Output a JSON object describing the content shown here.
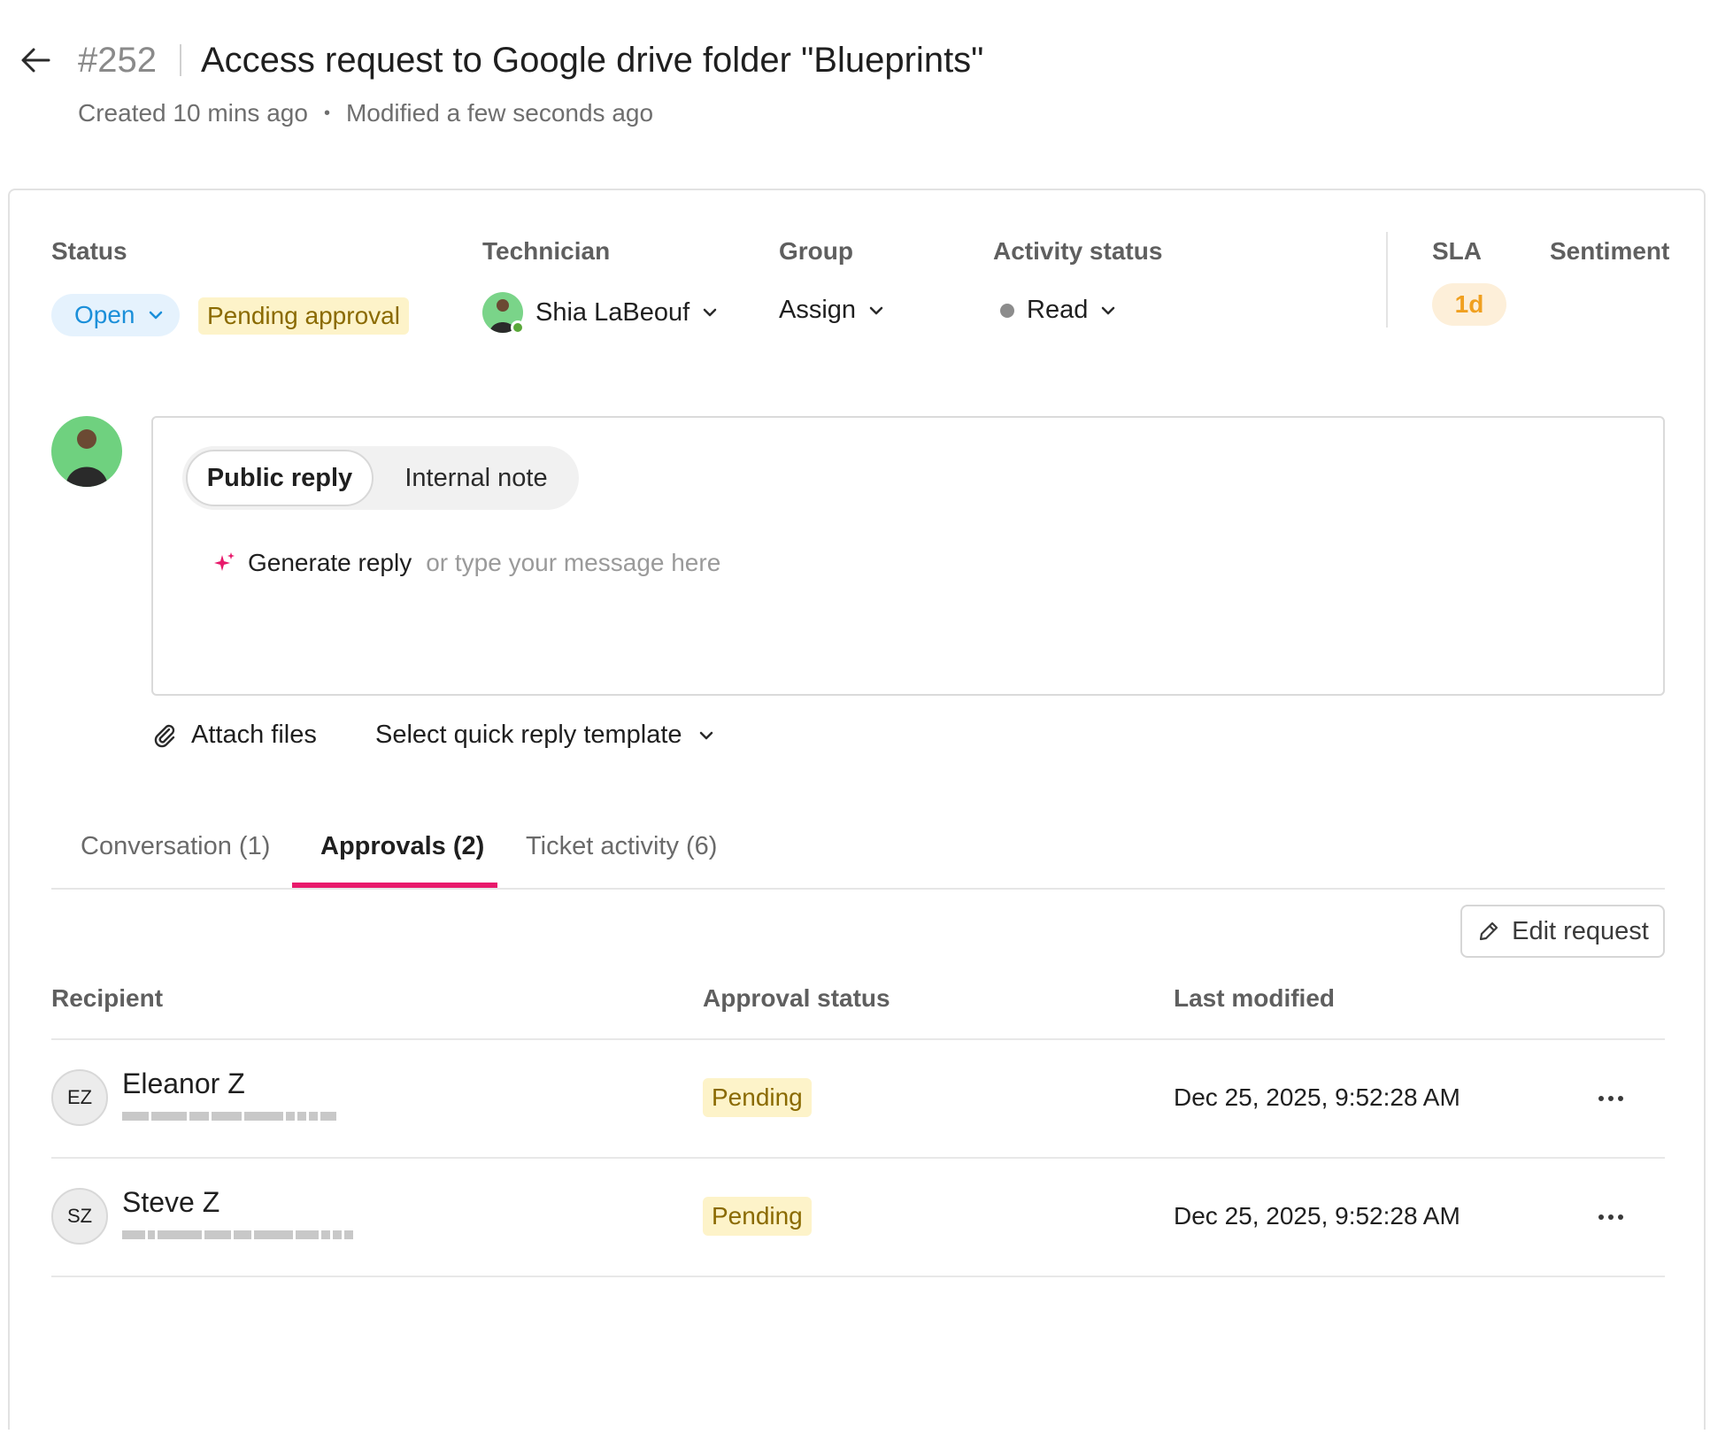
{
  "header": {
    "ticket_number": "#252",
    "title": "Access request to Google drive folder \"Blueprints\"",
    "created": "Created 10 mins ago",
    "separator": "•",
    "modified": "Modified a few seconds ago"
  },
  "fields": {
    "status_label": "Status",
    "status_value": "Open",
    "approval_badge": "Pending approval",
    "technician_label": "Technician",
    "technician_value": "Shia LaBeouf",
    "group_label": "Group",
    "group_value": "Assign",
    "activity_label": "Activity status",
    "activity_value": "Read",
    "sla_label": "SLA",
    "sla_value": "1d",
    "sentiment_label": "Sentiment"
  },
  "reply": {
    "mode_public": "Public reply",
    "mode_internal": "Internal note",
    "generate_label": "Generate reply",
    "placeholder": "or type your message here",
    "attach_label": "Attach files",
    "template_label": "Select quick reply template"
  },
  "tabs": [
    {
      "label": "Conversation (1)",
      "active": false
    },
    {
      "label": "Approvals (2)",
      "active": true
    },
    {
      "label": "Ticket activity (6)",
      "active": false
    }
  ],
  "edit_button": "Edit request",
  "table": {
    "columns": [
      "Recipient",
      "Approval status",
      "Last modified"
    ],
    "rows": [
      {
        "initials": "EZ",
        "name": "Eleanor Z",
        "status": "Pending",
        "modified": "Dec 25, 2025, 9:52:28 AM"
      },
      {
        "initials": "SZ",
        "name": "Steve Z",
        "status": "Pending",
        "modified": "Dec 25, 2025, 9:52:28 AM"
      }
    ]
  },
  "colors": {
    "accent_tab": "#e8196b",
    "status_open": "#1b8fd9",
    "pending_bg": "#fdf3c9",
    "sla_text": "#f0a020",
    "sparkle": "#e8196b"
  },
  "icons": [
    "arrow-left-icon",
    "chevron-down-icon",
    "sparkle-icon",
    "paperclip-icon",
    "pencil-icon",
    "more-horizontal-icon"
  ]
}
